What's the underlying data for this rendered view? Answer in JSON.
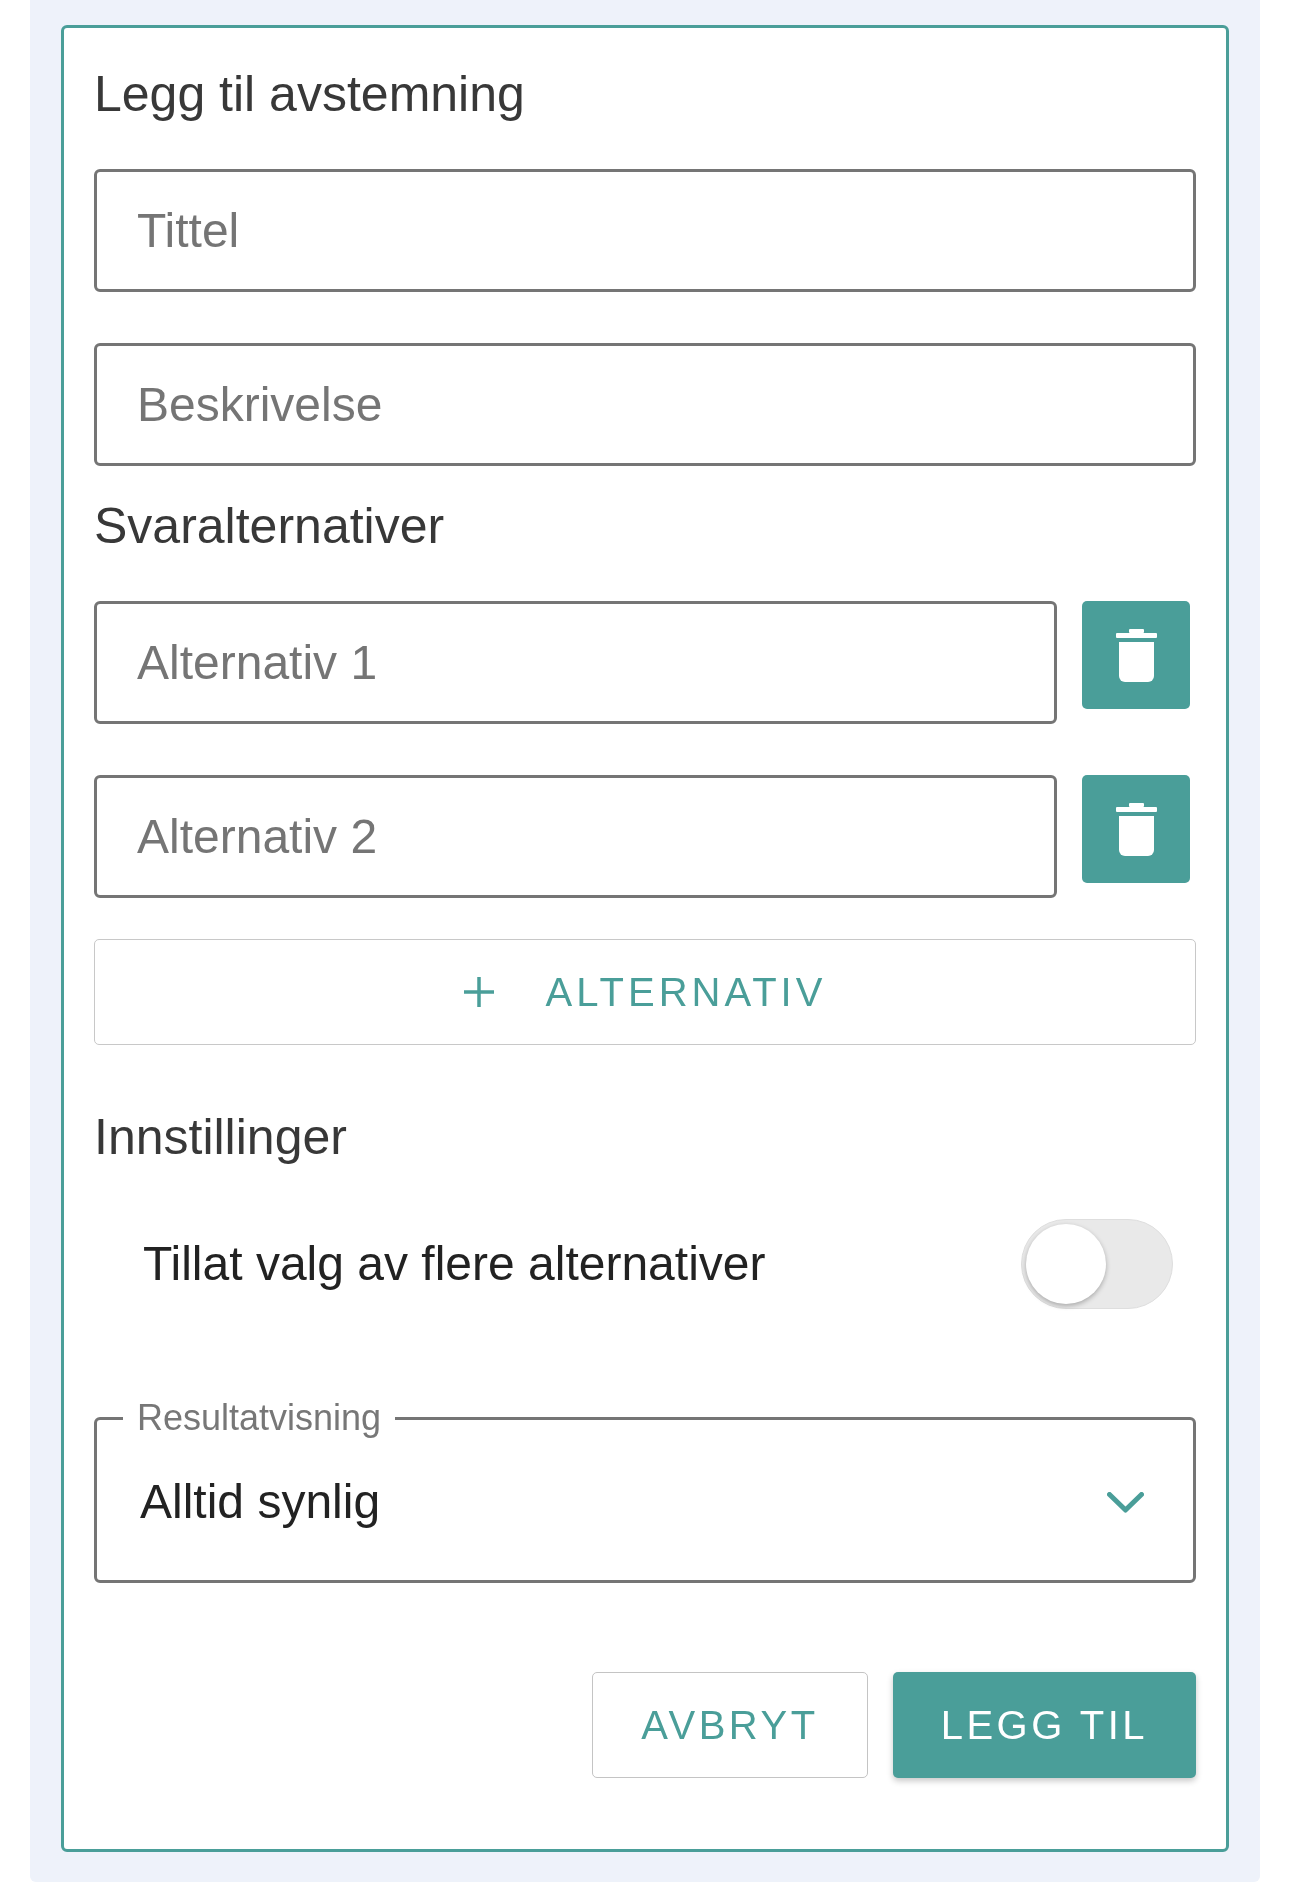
{
  "form": {
    "title": "Legg til avstemning"
  },
  "fields": [
    {
      "placeholder": "Tittel"
    },
    {
      "placeholder": "Beskrivelse"
    }
  ],
  "options_section": {
    "heading": "Svaralternativer",
    "options": [
      {
        "placeholder": "Alternativ 1"
      },
      {
        "placeholder": "Alternativ 2"
      }
    ],
    "add_button": {
      "label": "ALTERNATIV"
    }
  },
  "settings": {
    "heading": "Innstillinger",
    "toggles": [
      {
        "label": "Tillat valg av flere alternativer",
        "on": false
      }
    ],
    "result_select": {
      "label": "Resultatvisning",
      "value": "Alltid synlig"
    }
  },
  "buttons": [
    {
      "label": "AVBRYT",
      "kind": "outlined"
    },
    {
      "label": "LEGG TIL",
      "kind": "filled"
    }
  ]
}
